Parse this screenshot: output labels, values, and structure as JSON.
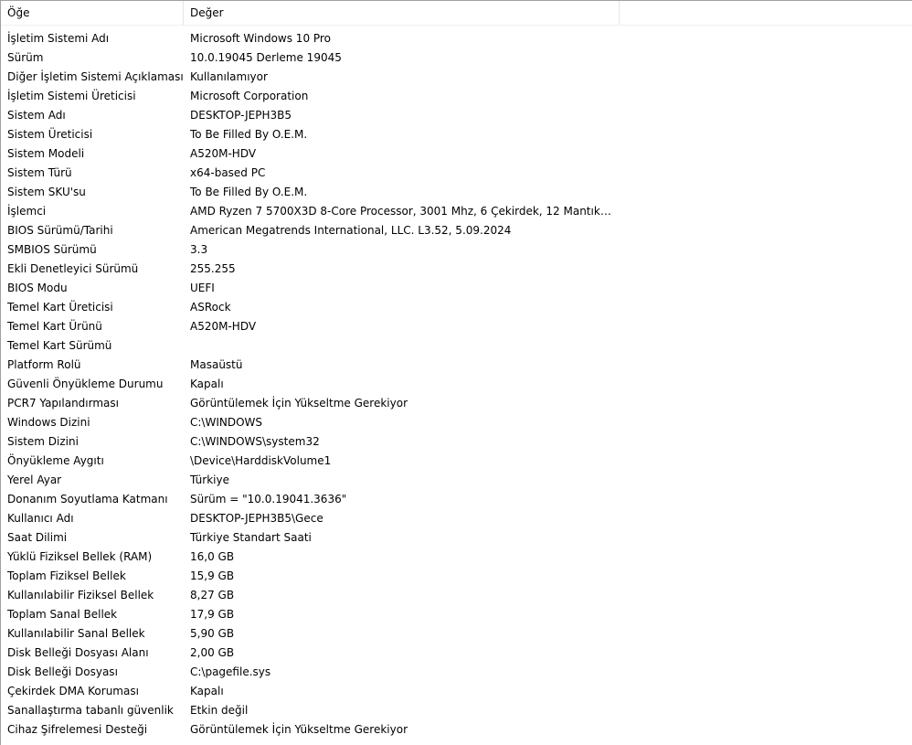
{
  "table": {
    "headers": {
      "item": "Öğe",
      "value": "Değer"
    },
    "rows": [
      {
        "item": "İşletim Sistemi Adı",
        "value": "Microsoft Windows 10 Pro"
      },
      {
        "item": "Sürüm",
        "value": "10.0.19045 Derleme 19045"
      },
      {
        "item": "Diğer İşletim Sistemi Açıklaması",
        "value": "Kullanılamıyor"
      },
      {
        "item": "İşletim Sistemi Üreticisi",
        "value": "Microsoft Corporation"
      },
      {
        "item": "Sistem Adı",
        "value": "DESKTOP-JEPH3B5"
      },
      {
        "item": "Sistem Üreticisi",
        "value": "To Be Filled By O.E.M."
      },
      {
        "item": "Sistem Modeli",
        "value": "A520M-HDV"
      },
      {
        "item": "Sistem Türü",
        "value": "x64-based PC"
      },
      {
        "item": "Sistem SKU'su",
        "value": "To Be Filled By O.E.M."
      },
      {
        "item": "İşlemci",
        "value": "AMD Ryzen 7 5700X3D 8-Core Processor, 3001 Mhz, 6 Çekirdek, 12 Mantıksal..."
      },
      {
        "item": "BIOS Sürümü/Tarihi",
        "value": "American Megatrends International, LLC. L3.52, 5.09.2024"
      },
      {
        "item": "SMBIOS Sürümü",
        "value": "3.3"
      },
      {
        "item": "Ekli Denetleyici Sürümü",
        "value": "255.255"
      },
      {
        "item": "BIOS Modu",
        "value": "UEFI"
      },
      {
        "item": "Temel Kart Üreticisi",
        "value": "ASRock"
      },
      {
        "item": "Temel Kart Ürünü",
        "value": "A520M-HDV"
      },
      {
        "item": "Temel Kart Sürümü",
        "value": ""
      },
      {
        "item": "Platform Rolü",
        "value": "Masaüstü"
      },
      {
        "item": "Güvenli Önyükleme Durumu",
        "value": "Kapalı"
      },
      {
        "item": "PCR7 Yapılandırması",
        "value": "Görüntülemek İçin Yükseltme Gerekiyor"
      },
      {
        "item": "Windows Dizini",
        "value": "C:\\WINDOWS"
      },
      {
        "item": "Sistem Dizini",
        "value": "C:\\WINDOWS\\system32"
      },
      {
        "item": "Önyükleme Aygıtı",
        "value": "\\Device\\HarddiskVolume1"
      },
      {
        "item": "Yerel Ayar",
        "value": "Türkiye"
      },
      {
        "item": "Donanım Soyutlama Katmanı",
        "value": "Sürüm = \"10.0.19041.3636\""
      },
      {
        "item": "Kullanıcı Adı",
        "value": "DESKTOP-JEPH3B5\\Gece"
      },
      {
        "item": "Saat Dilimi",
        "value": "Türkiye Standart Saati"
      },
      {
        "item": "Yüklü Fiziksel Bellek (RAM)",
        "value": "16,0 GB"
      },
      {
        "item": "Toplam Fiziksel Bellek",
        "value": "15,9 GB"
      },
      {
        "item": "Kullanılabilir Fiziksel Bellek",
        "value": "8,27 GB"
      },
      {
        "item": "Toplam Sanal Bellek",
        "value": "17,9 GB"
      },
      {
        "item": "Kullanılabilir Sanal Bellek",
        "value": "5,90 GB"
      },
      {
        "item": "Disk Belleği Dosyası Alanı",
        "value": "2,00 GB"
      },
      {
        "item": "Disk Belleği Dosyası",
        "value": "C:\\pagefile.sys"
      },
      {
        "item": "Çekirdek DMA Koruması",
        "value": "Kapalı"
      },
      {
        "item": "Sanallaştırma tabanlı güvenlik",
        "value": "Etkin değil"
      },
      {
        "item": "Cihaz Şifrelemesi Desteği",
        "value": "Görüntülemek İçin Yükseltme Gerekiyor"
      }
    ]
  }
}
